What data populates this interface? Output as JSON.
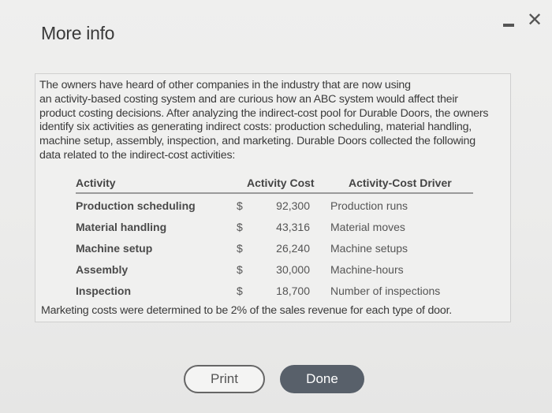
{
  "dialog": {
    "title": "More info",
    "minimize_icon": "minimize-icon",
    "close_icon": "close-icon",
    "close_glyph": "✕"
  },
  "content": {
    "intro": "The owners have heard of other companies in the industry that are now using an activity-based costing system and are curious how an ABC system would affect their product costing decisions. After analyzing the indirect-cost pool for Durable Doors, the owners identify six activities as generating indirect costs: production scheduling, material handling, machine setup, assembly, inspection, and marketing. Durable Doors collected the following data related to the indirect-cost activities:",
    "intro_lines": [
      "The owners have heard of other companies in the industry that are now using",
      "an activity-based costing system and are curious how an ABC system would affect their",
      "product costing decisions. After analyzing the indirect-cost pool for Durable Doors, the owners",
      "identify six activities as generating indirect costs: production scheduling, material handling,",
      "machine setup, assembly, inspection, and marketing. Durable Doors collected the following",
      "data related to the indirect-cost activities:"
    ],
    "table": {
      "headers": [
        "Activity",
        "Activity Cost",
        "Activity-Cost Driver"
      ],
      "rows": [
        {
          "activity": "Production scheduling",
          "currency": "$",
          "cost": "92,300",
          "driver": "Production runs"
        },
        {
          "activity": "Material handling",
          "currency": "$",
          "cost": "43,316",
          "driver": "Material moves"
        },
        {
          "activity": "Machine setup",
          "currency": "$",
          "cost": "26,240",
          "driver": "Machine setups"
        },
        {
          "activity": "Assembly",
          "currency": "$",
          "cost": "30,000",
          "driver": "Machine-hours"
        },
        {
          "activity": "Inspection",
          "currency": "$",
          "cost": "18,700",
          "driver": "Number of inspections"
        }
      ]
    },
    "note": "Marketing costs were determined to be 2% of the sales revenue for each type of door."
  },
  "buttons": {
    "print_label": "Print",
    "done_label": "Done"
  },
  "colors": {
    "done_bg": "#58606a",
    "background": "#ebebea"
  }
}
